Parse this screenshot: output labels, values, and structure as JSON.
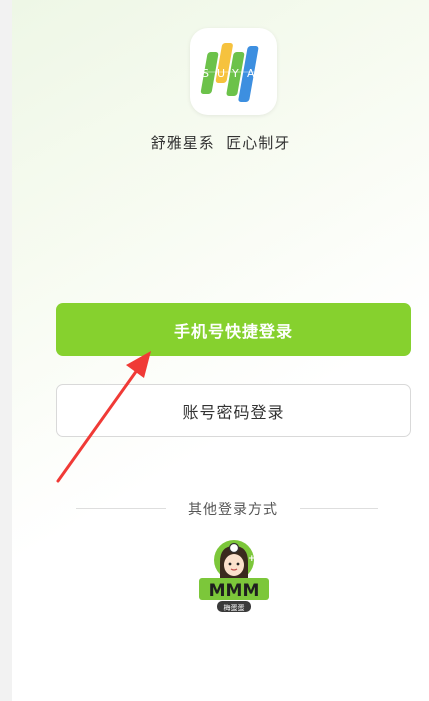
{
  "logo": {
    "letters": [
      "S",
      "U",
      "Y",
      "A"
    ],
    "icon": "suya-logo-icon"
  },
  "slogan": "舒雅星系  匠心制牙",
  "buttons": {
    "phone_login": "手机号快捷登录",
    "account_login": "账号密码登录"
  },
  "other_login": {
    "label": "其他登录方式",
    "provider": {
      "icon": "mmm-mascot-icon",
      "brand": "MMM",
      "subtitle": "梅蛋蛋"
    }
  },
  "colors": {
    "primary": "#86d12e",
    "annotation_arrow": "#f03a36",
    "logo_green": "#6cc24a",
    "logo_yellow": "#f6c23e",
    "logo_blue": "#3d8fe0"
  }
}
